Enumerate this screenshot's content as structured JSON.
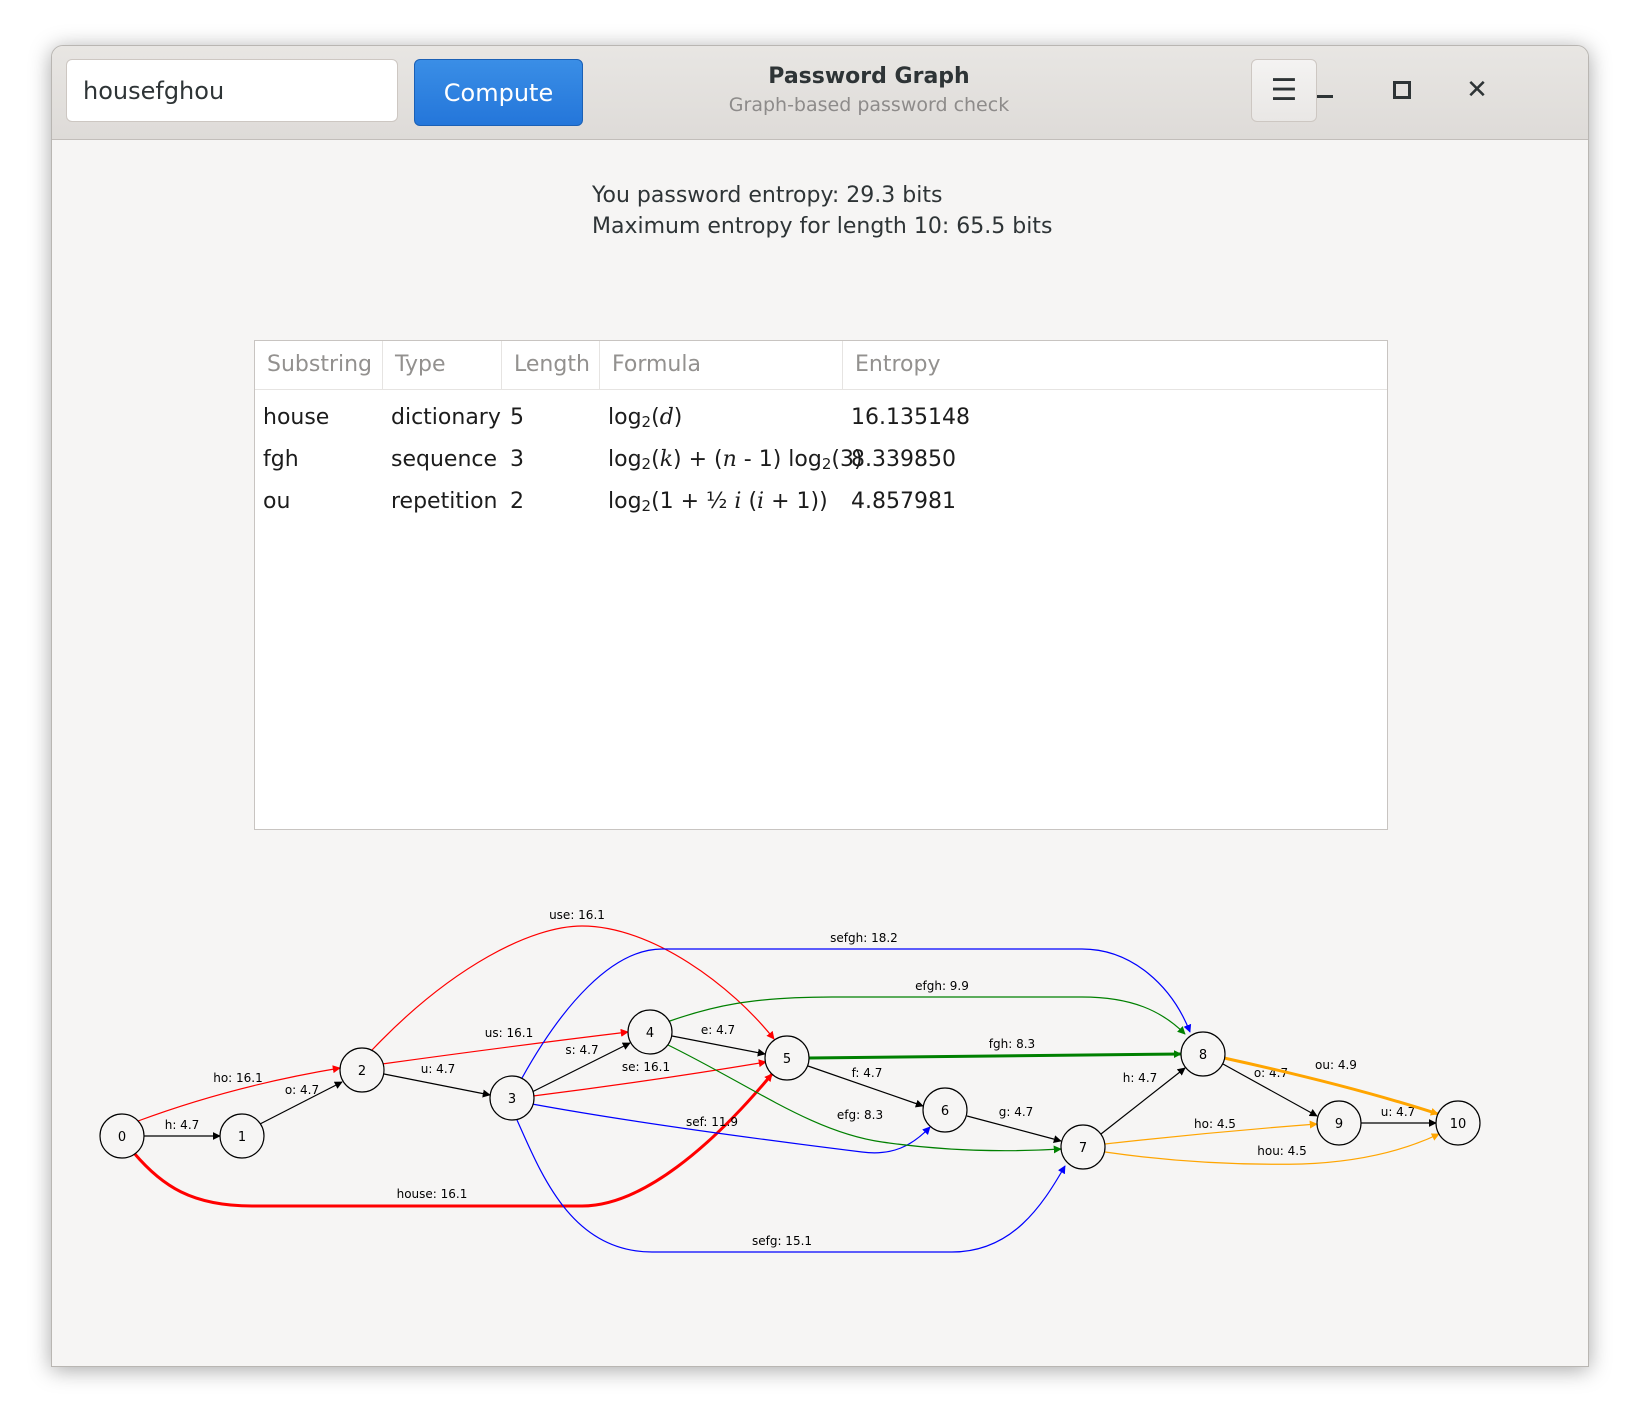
{
  "header": {
    "password_value": "housefghou",
    "compute_label": "Compute",
    "title": "Password Graph",
    "subtitle": "Graph-based password check"
  },
  "result": {
    "entropy_line": "You password entropy: 29.3 bits",
    "max_line": "Maximum entropy for length 10: 65.5 bits"
  },
  "table": {
    "headers": [
      "Substring",
      "Type",
      "Length",
      "Formula",
      "Entropy"
    ],
    "rows": [
      {
        "substring": "house",
        "type": "dictionary",
        "length": "5",
        "entropy": "16.135148"
      },
      {
        "substring": "fgh",
        "type": "sequence",
        "length": "3",
        "entropy": "8.339850"
      },
      {
        "substring": "ou",
        "type": "repetition",
        "length": "2",
        "entropy": "4.857981"
      }
    ]
  },
  "graph": {
    "nodes": [
      "0",
      "1",
      "2",
      "3",
      "4",
      "5",
      "6",
      "7",
      "8",
      "9",
      "10"
    ],
    "edges": [
      {
        "from": "0",
        "to": "1",
        "label": "h: 4.7",
        "color": "#000000",
        "bold": false
      },
      {
        "from": "1",
        "to": "2",
        "label": "o: 4.7",
        "color": "#000000",
        "bold": false
      },
      {
        "from": "2",
        "to": "3",
        "label": "u: 4.7",
        "color": "#000000",
        "bold": false
      },
      {
        "from": "3",
        "to": "4",
        "label": "s: 4.7",
        "color": "#000000",
        "bold": false
      },
      {
        "from": "4",
        "to": "5",
        "label": "e: 4.7",
        "color": "#000000",
        "bold": false
      },
      {
        "from": "5",
        "to": "6",
        "label": "f: 4.7",
        "color": "#000000",
        "bold": false
      },
      {
        "from": "6",
        "to": "7",
        "label": "g: 4.7",
        "color": "#000000",
        "bold": false
      },
      {
        "from": "7",
        "to": "8",
        "label": "h: 4.7",
        "color": "#000000",
        "bold": false
      },
      {
        "from": "8",
        "to": "9",
        "label": "o: 4.7",
        "color": "#000000",
        "bold": false
      },
      {
        "from": "9",
        "to": "10",
        "label": "u: 4.7",
        "color": "#000000",
        "bold": false
      },
      {
        "from": "0",
        "to": "2",
        "label": "ho: 16.1",
        "color": "#ff0000",
        "bold": false
      },
      {
        "from": "2",
        "to": "4",
        "label": "us: 16.1",
        "color": "#ff0000",
        "bold": false
      },
      {
        "from": "3",
        "to": "5",
        "label": "se: 16.1",
        "color": "#ff0000",
        "bold": false
      },
      {
        "from": "2",
        "to": "5",
        "label": "use: 16.1",
        "color": "#ff0000",
        "bold": false
      },
      {
        "from": "0",
        "to": "5",
        "label": "house: 16.1",
        "color": "#ff0000",
        "bold": true
      },
      {
        "from": "3",
        "to": "8",
        "label": "sefgh: 18.2",
        "color": "#0000ff",
        "bold": false
      },
      {
        "from": "3",
        "to": "6",
        "label": "sef: 11.9",
        "color": "#0000ff",
        "bold": false
      },
      {
        "from": "3",
        "to": "7",
        "label": "sefg: 15.1",
        "color": "#0000ff",
        "bold": false
      },
      {
        "from": "4",
        "to": "8",
        "label": "efgh: 9.9",
        "color": "#008000",
        "bold": false
      },
      {
        "from": "4",
        "to": "7",
        "label": "efg: 8.3",
        "color": "#008000",
        "bold": false
      },
      {
        "from": "5",
        "to": "8",
        "label": "fgh: 8.3",
        "color": "#008000",
        "bold": true
      },
      {
        "from": "8",
        "to": "10",
        "label": "ou: 4.9",
        "color": "#ffa500",
        "bold": true
      },
      {
        "from": "7",
        "to": "9",
        "label": "ho: 4.5",
        "color": "#ffa500",
        "bold": false
      },
      {
        "from": "7",
        "to": "10",
        "label": "hou: 4.5",
        "color": "#ffa500",
        "bold": false
      }
    ]
  }
}
